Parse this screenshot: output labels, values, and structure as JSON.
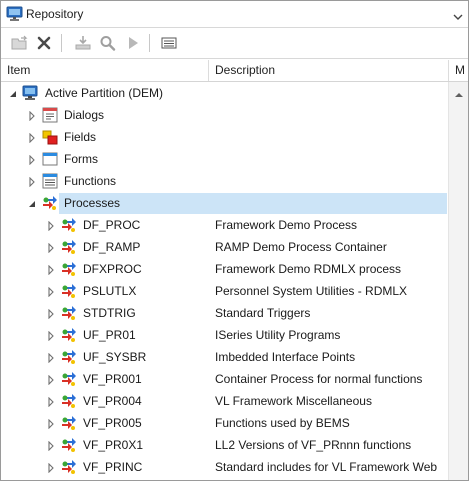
{
  "window": {
    "title": "Repository",
    "icon": "repository-icon"
  },
  "toolbar": {
    "buttons": [
      {
        "name": "open-folder-icon",
        "enabled": false
      },
      {
        "name": "delete-icon",
        "enabled": true
      },
      {
        "name": "import-icon",
        "enabled": false
      },
      {
        "name": "find-icon",
        "enabled": false
      },
      {
        "name": "run-icon",
        "enabled": false
      },
      {
        "name": "list-view-icon",
        "enabled": true
      }
    ]
  },
  "columns": {
    "item": "Item",
    "description": "Description",
    "third": "M"
  },
  "tree": {
    "root": {
      "label": "Active Partition (DEM)",
      "icon": "monitor-icon"
    },
    "categories": [
      {
        "label": "Dialogs",
        "icon": "dialog-icon"
      },
      {
        "label": "Fields",
        "icon": "fields-icon"
      },
      {
        "label": "Forms",
        "icon": "form-icon"
      },
      {
        "label": "Functions",
        "icon": "functions-icon"
      },
      {
        "label": "Processes",
        "icon": "process-icon"
      }
    ],
    "processes": [
      {
        "name": "DF_PROC",
        "description": "Framework Demo Process"
      },
      {
        "name": "DF_RAMP",
        "description": "RAMP Demo Process Container"
      },
      {
        "name": "DFXPROC",
        "description": "Framework Demo RDMLX process"
      },
      {
        "name": "PSLUTLX",
        "description": "Personnel System Utilities - RDMLX"
      },
      {
        "name": "STDTRIG",
        "description": "Standard Triggers"
      },
      {
        "name": "UF_PR01",
        "description": "ISeries Utility Programs"
      },
      {
        "name": "UF_SYSBR",
        "description": "Imbedded Interface Points"
      },
      {
        "name": "VF_PR001",
        "description": "Container Process for normal functions"
      },
      {
        "name": "VF_PR004",
        "description": "VL Framework Miscellaneous"
      },
      {
        "name": "VF_PR005",
        "description": "Functions used by BEMS"
      },
      {
        "name": "VF_PR0X1",
        "description": "LL2 Versions of VF_PRnnn functions"
      },
      {
        "name": "VF_PRINC",
        "description": "Standard includes for VL Framework Web"
      }
    ]
  },
  "colors": {
    "selection": "#cce4f7",
    "accent": "#2b6fc2"
  }
}
